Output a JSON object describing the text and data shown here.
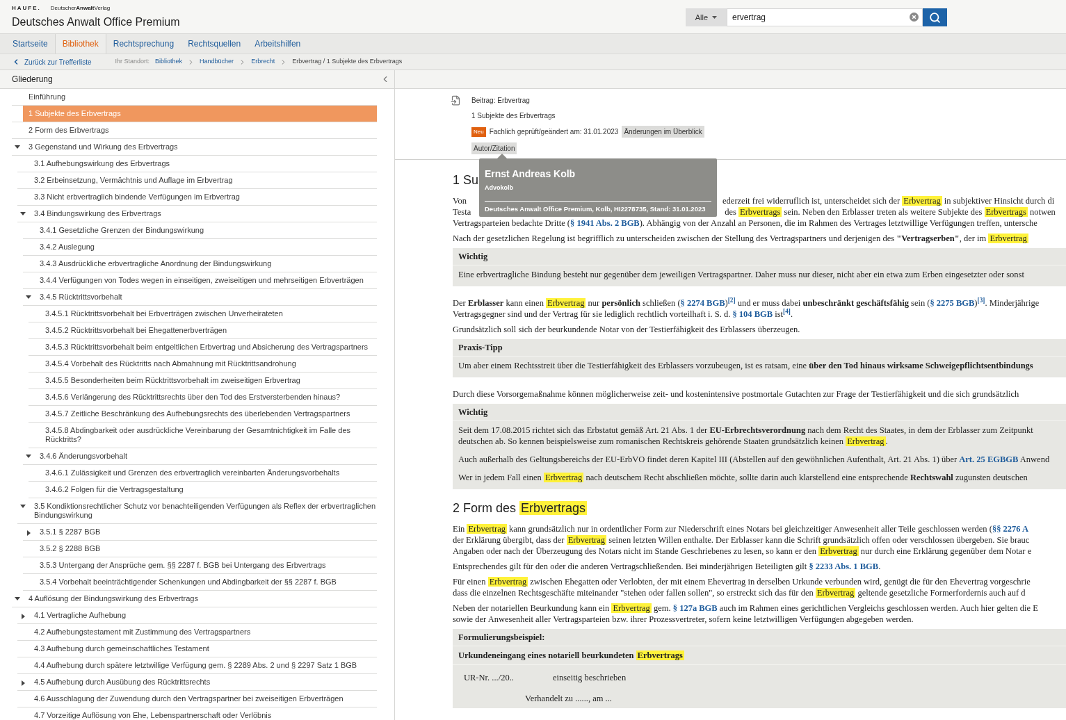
{
  "header": {
    "brand": "HAUFE.",
    "publisher": "Deutscher**Anwalt**Verlag",
    "title": "Deutsches Anwalt Office Premium"
  },
  "search": {
    "scope": "Alle",
    "value": "ervertrag"
  },
  "nav": {
    "tabs": [
      {
        "label": "Startseite",
        "selected": false
      },
      {
        "label": "Bibliothek",
        "selected": true
      },
      {
        "label": "Rechtsprechung",
        "selected": false
      },
      {
        "label": "Rechtsquellen",
        "selected": false
      },
      {
        "label": "Arbeitshilfen",
        "selected": false
      }
    ]
  },
  "breadcrumb": {
    "back": "Zurück zur Trefferliste",
    "location_label": "Ihr Standort:",
    "items": [
      {
        "label": "Bibliothek",
        "kind": "link"
      },
      {
        "label": "Handbücher",
        "kind": "link"
      },
      {
        "label": "Erbrecht",
        "kind": "link"
      },
      {
        "label": "Erbvertrag / 1 Subjekte des Erbvertrags",
        "kind": "current"
      }
    ]
  },
  "outline": {
    "title": "Gliederung",
    "items": [
      {
        "label": "Einführung",
        "selected": false
      },
      {
        "label": "1 Subjekte des Erbvertrags",
        "selected": true
      },
      {
        "label": "2 Form des Erbvertrags",
        "selected": false
      },
      {
        "label": "3 Gegenstand und Wirkung des Erbvertrags",
        "selected": false,
        "expanded": true,
        "children": [
          {
            "label": "3.1 Aufhebungswirkung des Erbvertrags",
            "selected": false
          },
          {
            "label": "3.2 Erbeinsetzung, Vermächtnis und Auflage im Erbvertrag",
            "selected": false
          },
          {
            "label": "3.3 Nicht erbvertraglich bindende Verfügungen im Erbvertrag",
            "selected": false
          },
          {
            "label": "3.4 Bindungswirkung des Erbvertrags",
            "selected": false,
            "expanded": true,
            "children": [
              {
                "label": "3.4.1 Gesetzliche Grenzen der Bindungswirkung",
                "selected": false
              },
              {
                "label": "3.4.2 Auslegung",
                "selected": false
              },
              {
                "label": "3.4.3 Ausdrückliche erbvertragliche Anordnung der Bindungswirkung",
                "selected": false
              },
              {
                "label": "3.4.4 Verfügungen von Todes wegen in einseitigen, zweiseitigen und mehrseitigen Erbverträgen",
                "selected": false
              },
              {
                "label": "3.4.5 Rücktrittsvorbehalt",
                "selected": false,
                "expanded": true,
                "children": [
                  {
                    "label": "3.4.5.1 Rücktrittsvorbehalt bei Erbverträgen zwischen Unverheirateten",
                    "selected": false
                  },
                  {
                    "label": "3.4.5.2 Rücktrittsvorbehalt bei Ehegattenerbverträgen",
                    "selected": false
                  },
                  {
                    "label": "3.4.5.3 Rücktrittsvorbehalt beim entgeltlichen Erbvertrag und Absicherung des Vertragspartners",
                    "selected": false
                  },
                  {
                    "label": "3.4.5.4 Vorbehalt des Rücktritts nach Abmahnung mit Rücktrittsandrohung",
                    "selected": false
                  },
                  {
                    "label": "3.4.5.5 Besonderheiten beim Rücktrittsvorbehalt im zweiseitigen Erbvertrag",
                    "selected": false
                  },
                  {
                    "label": "3.4.5.6 Verlängerung des Rücktrittsrechts über den Tod des Erstversterbenden hinaus?",
                    "selected": false
                  },
                  {
                    "label": "3.4.5.7 Zeitliche Beschränkung des Aufhebungsrechts des überlebenden Vertragspartners",
                    "selected": false
                  },
                  {
                    "label": "3.4.5.8 Abdingbarkeit oder ausdrückliche Vereinbarung der Gesamtnichtigkeit im Falle des Rücktritts?",
                    "selected": false
                  }
                ]
              },
              {
                "label": "3.4.6 Änderungsvorbehalt",
                "selected": false,
                "expanded": true,
                "children": [
                  {
                    "label": "3.4.6.1 Zulässigkeit und Grenzen des erbvertraglich vereinbarten Änderungsvorbehalts",
                    "selected": false
                  },
                  {
                    "label": "3.4.6.2 Folgen für die Vertragsgestaltung",
                    "selected": false
                  }
                ]
              }
            ]
          },
          {
            "label": "3.5 Kondiktionsrechtlicher Schutz vor benachteiligenden Verfügungen als Reflex der erbvertraglichen Bindungswirkung",
            "selected": false,
            "expanded": true,
            "children": [
              {
                "label": "3.5.1 § 2287 BGB",
                "selected": false,
                "expanded": false
              },
              {
                "label": "3.5.2 § 2288 BGB",
                "selected": false
              },
              {
                "label": "3.5.3 Untergang der Ansprüche gem. §§ 2287 f. BGB bei Untergang des Erbvertrags",
                "selected": false
              },
              {
                "label": "3.5.4 Vorbehalt beeinträchtigender Schenkungen und Abdingbarkeit der §§ 2287 f. BGB",
                "selected": false
              }
            ]
          }
        ]
      },
      {
        "label": "4 Auflösung der Bindungswirkung des Erbvertrags",
        "selected": false,
        "expanded": true,
        "children": [
          {
            "label": "4.1 Vertragliche Aufhebung",
            "selected": false,
            "expanded": false
          },
          {
            "label": "4.2 Aufhebungstestament mit Zustimmung des Vertragspartners",
            "selected": false
          },
          {
            "label": "4.3 Aufhebung durch gemeinschaftliches Testament",
            "selected": false
          },
          {
            "label": "4.4 Aufhebung durch spätere letztwillige Verfügung gem. § 2289 Abs. 2 und § 2297 Satz 1 BGB",
            "selected": false
          },
          {
            "label": "4.5 Aufhebung durch Ausübung des Rücktrittsrechts",
            "selected": false,
            "expanded": false
          },
          {
            "label": "4.6 Ausschlagung der Zuwendung durch den Vertragspartner bei zweiseitigen Erbverträgen",
            "selected": false
          },
          {
            "label": "4.7 Vorzeitige Auflösung von Ehe, Lebenspartnerschaft oder Verlöbnis",
            "selected": false
          }
        ]
      }
    ]
  },
  "article": {
    "meta": {
      "contribution": "Beitrag: Erbvertrag",
      "section": "1 Subjekte des Erbvertrags",
      "badge": "Neu",
      "reviewed": "Fachlich geprüft/geändert am: 31.01.2023",
      "changes_button": "Änderungen im Überblick",
      "author_button": "Autor/Zitation"
    },
    "tooltip": {
      "name": "Ernst Andreas Kolb",
      "firm": "Advokolb",
      "citation": "Deutsches Anwalt Office Premium, Kolb, HI2278735, Stand: 31.01.2023"
    },
    "blocks": [
      {
        "kind": "heading",
        "segments": [
          {
            "kind": "text",
            "text": "1 Su"
          }
        ]
      },
      {
        "kind": "paragraph",
        "lines": [
          [
            {
              "kind": "text",
              "text": "Von "
            },
            {
              "kind": "covered"
            },
            {
              "kind": "text",
              "text": "ederzeit frei widerruflich ist, unterscheidet sich der "
            },
            {
              "kind": "highlight",
              "text": "Erbvertrag"
            },
            {
              "kind": "text",
              "text": " in subjektiver Hinsicht durch di"
            }
          ],
          [
            {
              "kind": "text",
              "text": "Testa"
            },
            {
              "kind": "covered"
            },
            {
              "kind": "text",
              "text": "des "
            },
            {
              "kind": "highlight",
              "text": "Erbvertrags"
            },
            {
              "kind": "text",
              "text": " sein. Neben den Erblasser treten als weitere Subjekte des "
            },
            {
              "kind": "highlight",
              "text": "Erbvertrags"
            },
            {
              "kind": "text",
              "text": " notwen"
            }
          ],
          [
            {
              "kind": "text",
              "text": "Vertragsparteien bedachte Dritte ("
            },
            {
              "kind": "link",
              "text": "§ 1941 Abs. 2 BGB"
            },
            {
              "kind": "text",
              "text": "). Abhängig von der Anzahl an Personen, die im Rahmen des Vertrages letztwillige Verfügungen treffen, untersche"
            }
          ]
        ]
      },
      {
        "kind": "paragraph",
        "lines": [
          [
            {
              "kind": "text",
              "text": "Nach der gesetzlichen Regelung ist begrifflich zu unterscheiden zwischen der Stellung des Vertragspartners und derjenigen des **\"Vertragserben\"**, der im "
            },
            {
              "kind": "highlight",
              "text": "Erbvertrag"
            }
          ]
        ]
      },
      {
        "kind": "box",
        "title": "Wichtig",
        "items": [
          {
            "kind": "paragraph",
            "lines": [
              [
                {
                  "kind": "text",
                  "text": "Eine erbvertragliche Bindung besteht nur gegenüber dem jeweiligen Vertragspartner. Daher muss nur dieser, nicht aber ein etwa zum Erben eingesetzter oder sonst"
                }
              ]
            ]
          }
        ]
      },
      {
        "kind": "paragraph",
        "lines": [
          [
            {
              "kind": "text",
              "text": "Der **Erblasser** kann einen "
            },
            {
              "kind": "highlight",
              "text": "Erbvertrag"
            },
            {
              "kind": "text",
              "text": " nur **persönlich** schließen ("
            },
            {
              "kind": "link",
              "text": "§ 2274 BGB"
            },
            {
              "kind": "text",
              "text": ")"
            },
            {
              "kind": "link",
              "text": "$^{[2]}$"
            },
            {
              "kind": "text",
              "text": " und er muss dabei **unbeschränkt geschäftsfähig** sein ("
            },
            {
              "kind": "link",
              "text": "§ 2275 BGB"
            },
            {
              "kind": "text",
              "text": ")"
            },
            {
              "kind": "link",
              "text": "$^{[3]}$"
            },
            {
              "kind": "text",
              "text": ". Minderjährige"
            }
          ],
          [
            {
              "kind": "text",
              "text": "Vertragsgegner sind und der Vertrag für sie lediglich rechtlich vorteilhaft i. S. d. "
            },
            {
              "kind": "link",
              "text": "§ 104 BGB"
            },
            {
              "kind": "text",
              "text": " ist"
            },
            {
              "kind": "link",
              "text": "$^{[4]}$"
            },
            {
              "kind": "text",
              "text": "."
            }
          ]
        ]
      },
      {
        "kind": "paragraph",
        "lines": [
          [
            {
              "kind": "text",
              "text": "Grundsätzlich soll sich der beurkundende Notar von der Testierfähigkeit des Erblassers überzeugen."
            }
          ]
        ]
      },
      {
        "kind": "box",
        "title": "Praxis-Tipp",
        "items": [
          {
            "kind": "paragraph",
            "lines": [
              [
                {
                  "kind": "text",
                  "text": "Um aber einem Rechtsstreit über die Testierfähigkeit des Erblassers vorzubeugen, ist es ratsam, eine **über den Tod hinaus wirksame Schweigepflichtsentbindungs**"
                }
              ]
            ]
          }
        ]
      },
      {
        "kind": "paragraph",
        "lines": [
          [
            {
              "kind": "text",
              "text": "Durch diese Vorsorgemaßnahme können möglicherweise zeit- und kostenintensive postmortale Gutachten zur Frage der Testierfähigkeit und die sich grundsätzlich"
            }
          ]
        ]
      },
      {
        "kind": "box",
        "title": "Wichtig",
        "items": [
          {
            "kind": "paragraph",
            "lines": [
              [
                {
                  "kind": "text",
                  "text": "Seit dem 17.08.2015 richtet sich das Erbstatut gemäß Art. 21 Abs. 1 der **EU-Erbrechtsverordnung** nach dem Recht des Staates, in dem der Erblasser zum Zeitpunkt"
                }
              ],
              [
                {
                  "kind": "text",
                  "text": "deutschen ab. So kennen beispielsweise zum romanischen Rechtskreis gehörende Staaten grundsätzlich keinen "
                },
                {
                  "kind": "highlight",
                  "text": "Erbvertrag"
                },
                {
                  "kind": "text",
                  "text": "."
                }
              ]
            ]
          },
          {
            "kind": "paragraph",
            "lines": [
              [
                {
                  "kind": "text",
                  "text": "Auch außerhalb des Geltungsbereichs der EU-ErbVO findet deren Kapitel III (Abstellen auf den gewöhnlichen Aufenthalt, Art. 21 Abs. 1) über "
                },
                {
                  "kind": "link",
                  "text": "Art. 25 EGBGB"
                },
                {
                  "kind": "text",
                  "text": " Anwend"
                }
              ]
            ]
          },
          {
            "kind": "paragraph",
            "lines": [
              [
                {
                  "kind": "text",
                  "text": "Wer in jedem Fall einen "
                },
                {
                  "kind": "highlight",
                  "text": "Erbvertrag"
                },
                {
                  "kind": "text",
                  "text": " nach deutschem Recht abschließen möchte, sollte darin auch klarstellend eine entsprechende **Rechtswahl** zugunsten deutschen"
                }
              ]
            ]
          }
        ]
      },
      {
        "kind": "heading",
        "segments": [
          {
            "kind": "text",
            "text": "2 Form des "
          },
          {
            "kind": "highlight",
            "text": "Erbvertrags"
          }
        ]
      },
      {
        "kind": "paragraph",
        "lines": [
          [
            {
              "kind": "text",
              "text": "Ein "
            },
            {
              "kind": "highlight",
              "text": "Erbvertrag"
            },
            {
              "kind": "text",
              "text": " kann grundsätzlich nur in ordentlicher Form zur Niederschrift eines Notars bei gleichzeitiger Anwesenheit aller Teile geschlossen werden ("
            },
            {
              "kind": "link",
              "text": "§§ 2276 A"
            }
          ],
          [
            {
              "kind": "text",
              "text": "der Erklärung übergibt, dass der "
            },
            {
              "kind": "highlight",
              "text": "Erbvertrag"
            },
            {
              "kind": "text",
              "text": " seinen letzten Willen enthalte. Der Erblasser kann die Schrift grundsätzlich offen oder verschlossen übergeben. Sie brauc"
            }
          ],
          [
            {
              "kind": "text",
              "text": "Angaben oder nach der Überzeugung des Notars nicht im Stande Geschriebenes zu lesen, so kann er den "
            },
            {
              "kind": "highlight",
              "text": "Erbvertrag"
            },
            {
              "kind": "text",
              "text": " nur durch eine Erklärung gegenüber dem Notar e"
            }
          ]
        ]
      },
      {
        "kind": "paragraph",
        "lines": [
          [
            {
              "kind": "text",
              "text": "Entsprechendes gilt für den oder die anderen Vertragschließenden. Bei minderjährigen Beteiligten gilt "
            },
            {
              "kind": "link",
              "text": "§ 2233 Abs. 1 BGB"
            },
            {
              "kind": "text",
              "text": "."
            }
          ]
        ]
      },
      {
        "kind": "paragraph",
        "lines": [
          [
            {
              "kind": "text",
              "text": "Für einen "
            },
            {
              "kind": "highlight",
              "text": "Erbvertrag"
            },
            {
              "kind": "text",
              "text": " zwischen Ehegatten oder Verlobten, der mit einem Ehevertrag in derselben Urkunde verbunden wird, genügt die für den Ehevertrag vorgeschrie"
            }
          ],
          [
            {
              "kind": "text",
              "text": "dass die einzelnen Rechtsgeschäfte miteinander \"stehen oder fallen sollen\", so erstreckt sich das für den "
            },
            {
              "kind": "highlight",
              "text": "Erbvertrag"
            },
            {
              "kind": "text",
              "text": " geltende gesetzliche Formerfordernis auch auf d"
            }
          ]
        ]
      },
      {
        "kind": "paragraph",
        "lines": [
          [
            {
              "kind": "text",
              "text": "Neben der notariellen Beurkundung kann ein "
            },
            {
              "kind": "highlight",
              "text": "Erbvertrag"
            },
            {
              "kind": "text",
              "text": " gem. "
            },
            {
              "kind": "link",
              "text": "§ 127a BGB"
            },
            {
              "kind": "text",
              "text": " auch im Rahmen eines gerichtlichen Vergleichs geschlossen werden. Auch hier gelten die E"
            }
          ],
          [
            {
              "kind": "text",
              "text": "sowie der Anwesenheit aller Vertragsparteien bzw. ihrer Prozessvertreter, sofern keine letztwilligen Verfügungen abgegeben werden."
            }
          ]
        ]
      },
      {
        "kind": "box",
        "title": "Formulierungsbeispiel:",
        "items": [
          {
            "kind": "subheading",
            "segments": [
              {
                "kind": "text",
                "text": "**Urkundeneingang eines notariell beurkundeten** "
              },
              {
                "kind": "highlight",
                "text": "**Erbvertrags**"
              }
            ]
          },
          {
            "kind": "form_row",
            "cells": [
              "UR-Nr. .../20..",
              "einseitig beschrieben"
            ]
          },
          {
            "kind": "form_line_indented",
            "text": "Verhandelt zu ......, am ..."
          }
        ]
      }
    ]
  }
}
